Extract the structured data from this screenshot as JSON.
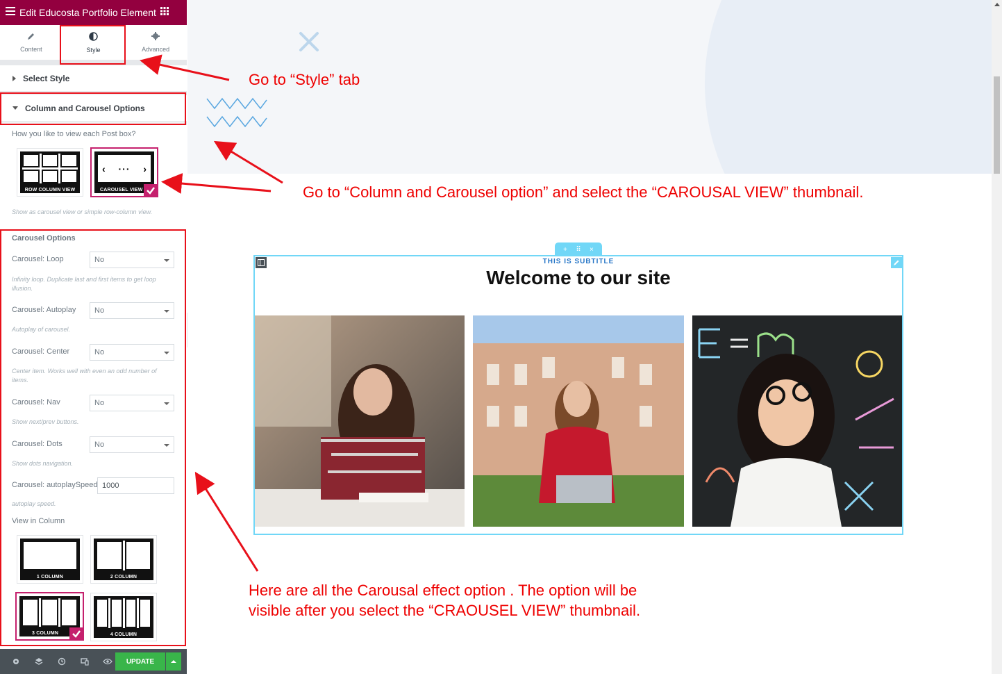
{
  "header": {
    "title": "Edit Educosta Portfolio Element",
    "menu_icon": "hamburger-icon",
    "apps_icon": "grid-icon"
  },
  "tabs": [
    {
      "label": "Content",
      "icon": "pencil-icon"
    },
    {
      "label": "Style",
      "icon": "contrast-icon"
    },
    {
      "label": "Advanced",
      "icon": "gear-icon"
    }
  ],
  "sections": {
    "select_style": "Select Style",
    "column_carousel": "Column and Carousel Options"
  },
  "view_question": "How you like to view each Post box?",
  "view_options": [
    {
      "caption": "ROW COLUMN VIEW",
      "selected": false
    },
    {
      "caption": "CAROUSEL VIEW",
      "selected": true
    }
  ],
  "view_hint": "Show as carousel view or simple row-column view.",
  "carousel": {
    "heading": "Carousel Options",
    "loop": {
      "label": "Carousel: Loop",
      "value": "No",
      "hint": "Infinity loop. Duplicate last and first items to get loop illusion."
    },
    "autoplay": {
      "label": "Carousel: Autoplay",
      "value": "No",
      "hint": "Autoplay of carousel."
    },
    "center": {
      "label": "Carousel: Center",
      "value": "No",
      "hint": "Center item. Works well with even an odd number of items."
    },
    "nav": {
      "label": "Carousel: Nav",
      "value": "No",
      "hint": "Show next/prev buttons."
    },
    "dots": {
      "label": "Carousel: Dots",
      "value": "No",
      "hint": "Show dots navigation."
    },
    "speed": {
      "label": "Carousel: autoplaySpeed",
      "value": "1000",
      "hint": "autoplay speed."
    }
  },
  "view_in_column": {
    "label": "View in Column",
    "options": [
      {
        "caption": "1 COLUMN",
        "cols": 1,
        "selected": false
      },
      {
        "caption": "2 COLUMN",
        "cols": 2,
        "selected": false
      },
      {
        "caption": "3 COLUMN",
        "cols": 3,
        "selected": true
      },
      {
        "caption": "4 COLUMN",
        "cols": 4,
        "selected": false
      }
    ]
  },
  "footer": {
    "icons": [
      "settings-icon",
      "layers-icon",
      "history-icon",
      "responsive-icon",
      "preview-icon"
    ],
    "update_label": "UPDATE"
  },
  "canvas": {
    "subtitle": "THIS IS SUBTITLE",
    "heading": "Welcome to our site",
    "photos": [
      "student-reading-photo",
      "student-laptop-photo",
      "girl-chalkboard-photo"
    ]
  },
  "annotations": {
    "style_tab": "Go  to “Style” tab",
    "column_option": "Go to “Column and Carousel option” and select the “CAROUSAL VIEW” thumbnail.",
    "all_options_line1": "Here are all the Carousal effect option . The option will be",
    "all_options_line2": "visible after you select the “CRAOUSEL VIEW” thumbnail."
  },
  "colors": {
    "brand": "#93003f",
    "accent": "#c5206d",
    "annotation": "#e8101a",
    "element_outline": "#71d7f7",
    "update": "#39b54a"
  }
}
